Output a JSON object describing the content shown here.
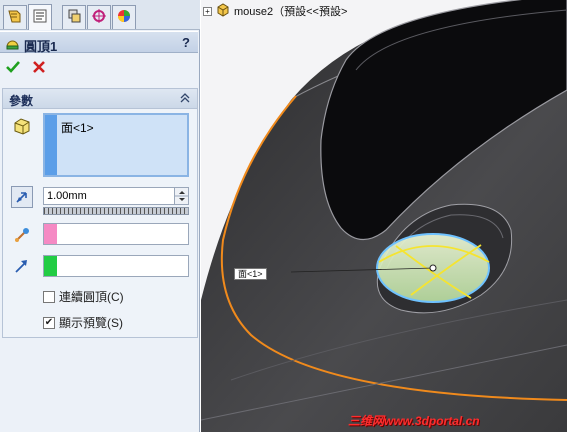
{
  "panel": {
    "tabs": [
      {
        "icon": "feature-manager-icon"
      },
      {
        "icon": "property-manager-icon"
      },
      {
        "icon": "configuration-manager-icon"
      },
      {
        "icon": "dimxpert-icon"
      },
      {
        "icon": "display-manager-icon"
      }
    ],
    "title": "圓頂1",
    "help": "?",
    "group_title": "參數",
    "selection_item": "面<1>",
    "distance": "1.00mm",
    "checkboxes": [
      {
        "label": "連續圓頂(C)",
        "checked": false
      },
      {
        "label": "顯示預覽(S)",
        "checked": true
      }
    ],
    "colors": {
      "selection_stripe": "#5b9ee8",
      "pink_swatch": "#f58ac4",
      "green_swatch": "#22cc44",
      "ok": "#1fa01f",
      "cancel": "#d02020"
    }
  },
  "viewport": {
    "tree_label": "mouse2（預設<<預設>",
    "face_label": "面<1>",
    "watermark": "三维网www.3dportal.cn"
  }
}
